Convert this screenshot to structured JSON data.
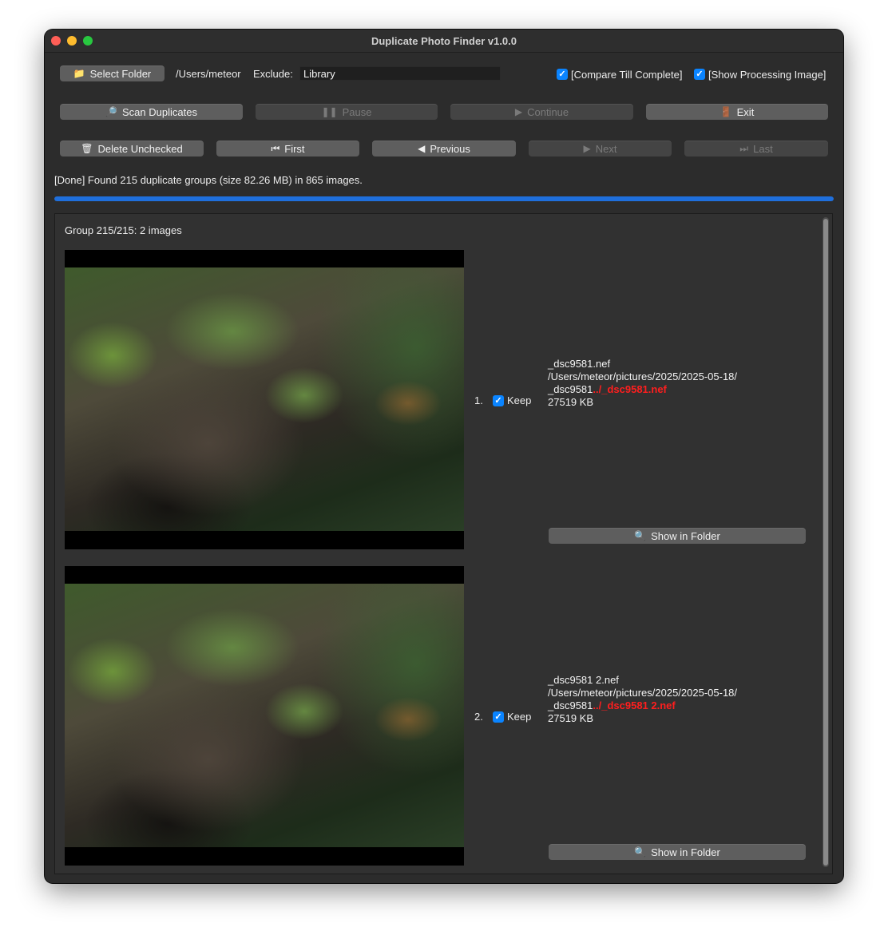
{
  "window": {
    "title": "Duplicate Photo Finder v1.0.0"
  },
  "toolbar": {
    "select_folder_label": "Select Folder",
    "folder_path": "/Users/meteor",
    "exclude_label": "Exclude:",
    "exclude_value": "Library",
    "compare_till_complete_label": "[Compare Till Complete]",
    "compare_till_complete_checked": true,
    "show_processing_image_label": "[Show Processing Image]",
    "show_processing_image_checked": true,
    "scan_label": "Scan Duplicates",
    "pause_label": "Pause",
    "continue_label": "Continue",
    "exit_label": "Exit",
    "delete_unchecked_label": "Delete Unchecked",
    "first_label": "First",
    "previous_label": "Previous",
    "next_label": "Next",
    "last_label": "Last"
  },
  "status": {
    "text": "[Done] Found 215 duplicate groups (size 82.26 MB) in 865 images.",
    "progress": 1.0
  },
  "group": {
    "header": "Group 215/215: 2 images",
    "items": [
      {
        "index": "1.",
        "keep_label": "Keep",
        "keep_checked": true,
        "filename": "_dsc9581.nef",
        "path_line1": "/Users/meteor/pictures/2025/2025-05-18/",
        "path_line2_prefix": "_dsc9581",
        "path_line2_red": "../_dsc9581.nef",
        "size": "27519 KB",
        "show_in_folder_label": "Show in Folder"
      },
      {
        "index": "2.",
        "keep_label": "Keep",
        "keep_checked": true,
        "filename": "_dsc9581 2.nef",
        "path_line1": "/Users/meteor/pictures/2025/2025-05-18/",
        "path_line2_prefix": "_dsc9581",
        "path_line2_red": "../_dsc9581 2.nef",
        "size": "27519 KB",
        "show_in_folder_label": "Show in Folder"
      }
    ]
  },
  "colors": {
    "accent": "#0a84ff",
    "progress": "#1f6fdc",
    "highlight_red": "#ff1e1e"
  }
}
